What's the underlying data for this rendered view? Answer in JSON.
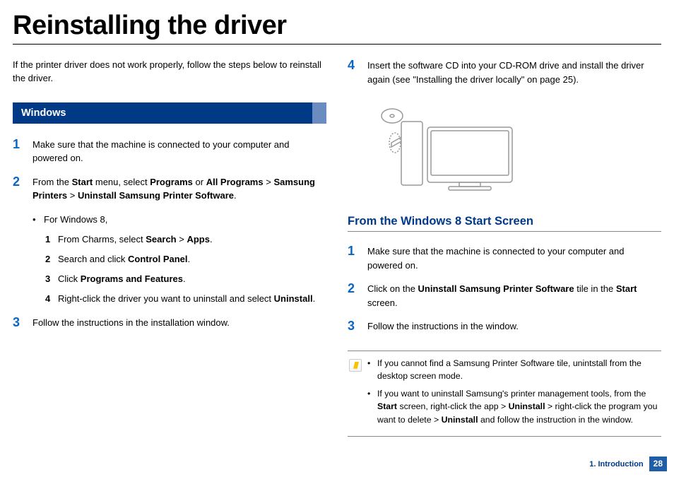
{
  "title": "Reinstalling the driver",
  "intro": "If the printer driver does not work properly, follow the steps below to reinstall the driver.",
  "windows": {
    "heading": "Windows",
    "step1": "Make sure that the machine is connected to your computer and powered on.",
    "step2_pre": "From the ",
    "step2_start": "Start",
    "step2_m1": " menu, select ",
    "step2_prog": "Programs",
    "step2_or": " or ",
    "step2_all": "All Programs",
    "step2_gt1": " > ",
    "step2_samsung": "Samsung Printers",
    "step2_gt2": " > ",
    "step2_uninstall": "Uninstall Samsung Printer Software",
    "step2_dot": ".",
    "win8_for": "For Windows 8,",
    "win8_s1_a": "From Charms, select ",
    "win8_s1_search": "Search",
    "win8_s1_gt": " > ",
    "win8_s1_apps": "Apps",
    "win8_s1_dot": ".",
    "win8_s2_a": "Search and click ",
    "win8_s2_cp": "Control Panel",
    "win8_s2_dot": ".",
    "win8_s3_a": "Click ",
    "win8_s3_pf": "Programs and Features",
    "win8_s3_dot": ".",
    "win8_s4_a": "Right-click the driver you want to uninstall and select ",
    "win8_s4_un": "Uninstall",
    "win8_s4_dot": ".",
    "step3": "Follow the instructions in the installation window.",
    "step4": "Insert the software CD into your CD-ROM drive and install the driver again (see \"Installing the driver locally\" on page 25)."
  },
  "win8screen": {
    "heading": "From the Windows 8 Start Screen",
    "step1": "Make sure that the machine is connected to your computer and powered on.",
    "step2_a": "Click on the ",
    "step2_b": "Uninstall Samsung Printer Software",
    "step2_c": " tile in the ",
    "step2_d": "Start",
    "step2_e": " screen.",
    "step3": "Follow the instructions in the window."
  },
  "notes": {
    "n1": "If you cannot find a Samsung Printer Software tile, unintstall from the desktop screen mode.",
    "n2_a": "If you want to uninstall Samsung's printer management tools, from the ",
    "n2_start": "Start",
    "n2_b": " screen, right-click the app > ",
    "n2_un1": "Uninstall",
    "n2_c": " > right-click the program you want to delete > ",
    "n2_un2": "Uninstall",
    "n2_d": " and follow the instruction in the window."
  },
  "footer": {
    "chapter": "1. Introduction",
    "page": "28"
  }
}
